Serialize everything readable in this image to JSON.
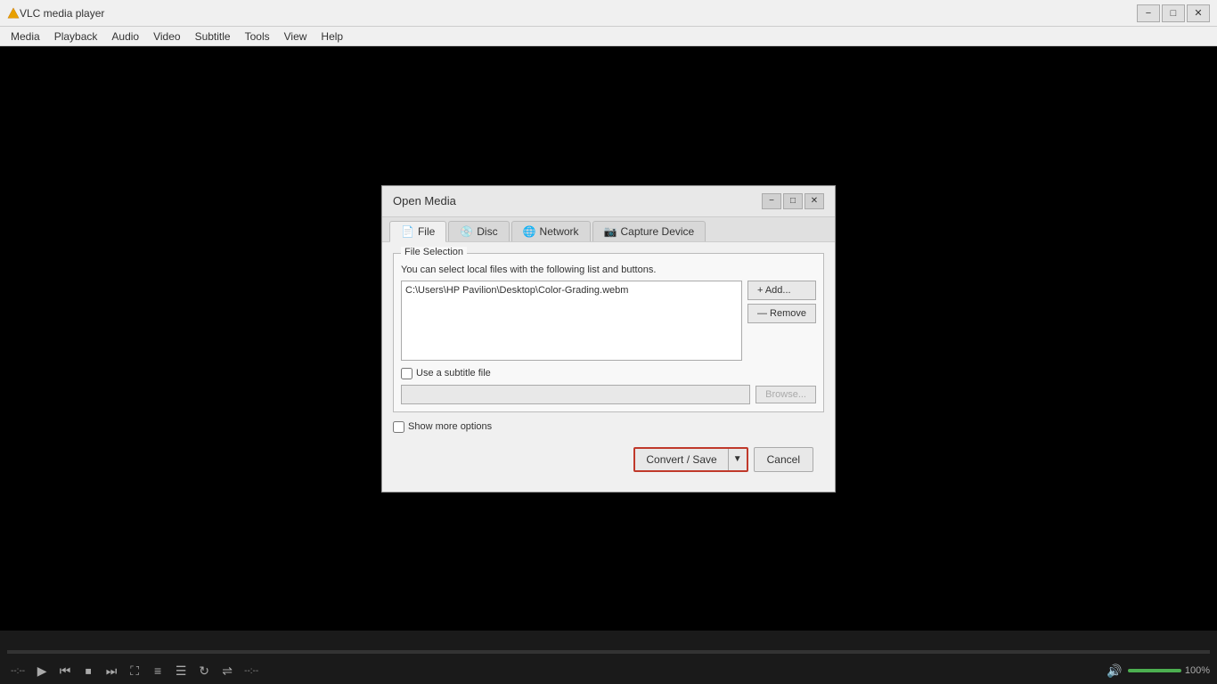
{
  "app": {
    "title": "VLC media player",
    "menu": [
      "Media",
      "Playback",
      "Audio",
      "Video",
      "Subtitle",
      "Tools",
      "View",
      "Help"
    ]
  },
  "titlebar": {
    "minimize": "−",
    "maximize": "□",
    "close": "✕"
  },
  "dialog": {
    "title": "Open Media",
    "tabs": [
      {
        "id": "file",
        "label": "File",
        "icon": "📄",
        "active": true
      },
      {
        "id": "disc",
        "label": "Disc",
        "icon": "💿",
        "active": false
      },
      {
        "id": "network",
        "label": "Network",
        "icon": "🌐",
        "active": false
      },
      {
        "id": "capture",
        "label": "Capture Device",
        "icon": "📷",
        "active": false
      }
    ],
    "file_selection": {
      "group_label": "File Selection",
      "description": "You can select local files with the following list and buttons.",
      "file_path": "C:\\Users\\HP Pavilion\\Desktop\\Color-Grading.webm",
      "add_button": "+ Add...",
      "remove_button": "— Remove"
    },
    "subtitle": {
      "checkbox_label": "Use a subtitle file",
      "checked": false,
      "input_placeholder": "",
      "browse_label": "Browse..."
    },
    "show_more": {
      "checked": false,
      "label": "Show more options"
    },
    "buttons": {
      "convert_save": "Convert / Save",
      "dropdown_arrow": "▼",
      "cancel": "Cancel"
    }
  },
  "bottom_controls": {
    "time_left": "--:--",
    "time_right": "--:--",
    "volume_label": "100%"
  }
}
